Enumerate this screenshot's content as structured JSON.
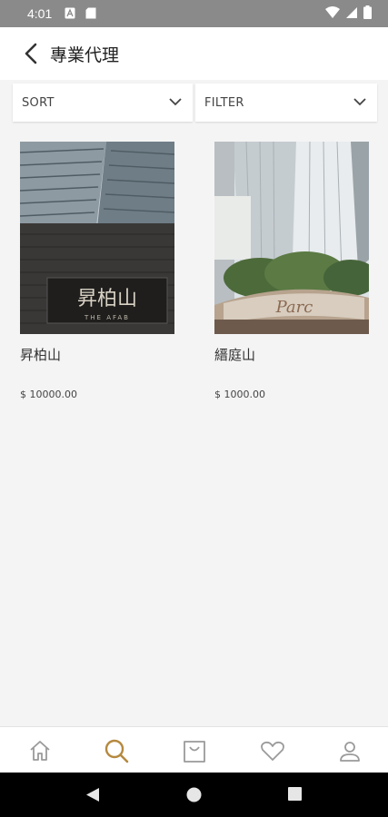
{
  "status_bar": {
    "time": "4:01",
    "left_icons": [
      "a-notification-icon",
      "sd-card-icon"
    ],
    "right_icons": [
      "wifi-icon",
      "signal-icon",
      "battery-icon"
    ]
  },
  "header": {
    "back_icon": "chevron-left-icon",
    "title": "專業代理"
  },
  "filters": {
    "sort_label": "SORT",
    "filter_label": "FILTER"
  },
  "products": [
    {
      "name": "昇柏山",
      "price": "$ 10000.00",
      "sign_text": "昇柏山",
      "sign_sub": "THE AFAB"
    },
    {
      "name": "縉庭山",
      "price": "$ 1000.00",
      "sign_text": "Parc"
    }
  ],
  "bottom_nav": {
    "items": [
      "home-icon",
      "search-icon",
      "shopping-bag-icon",
      "heart-icon",
      "profile-icon"
    ],
    "active_index": 1,
    "active_color": "#b5893f",
    "inactive_color": "#9a9a9a"
  },
  "system_nav": [
    "back-triangle-icon",
    "home-circle-icon",
    "recents-square-icon"
  ]
}
